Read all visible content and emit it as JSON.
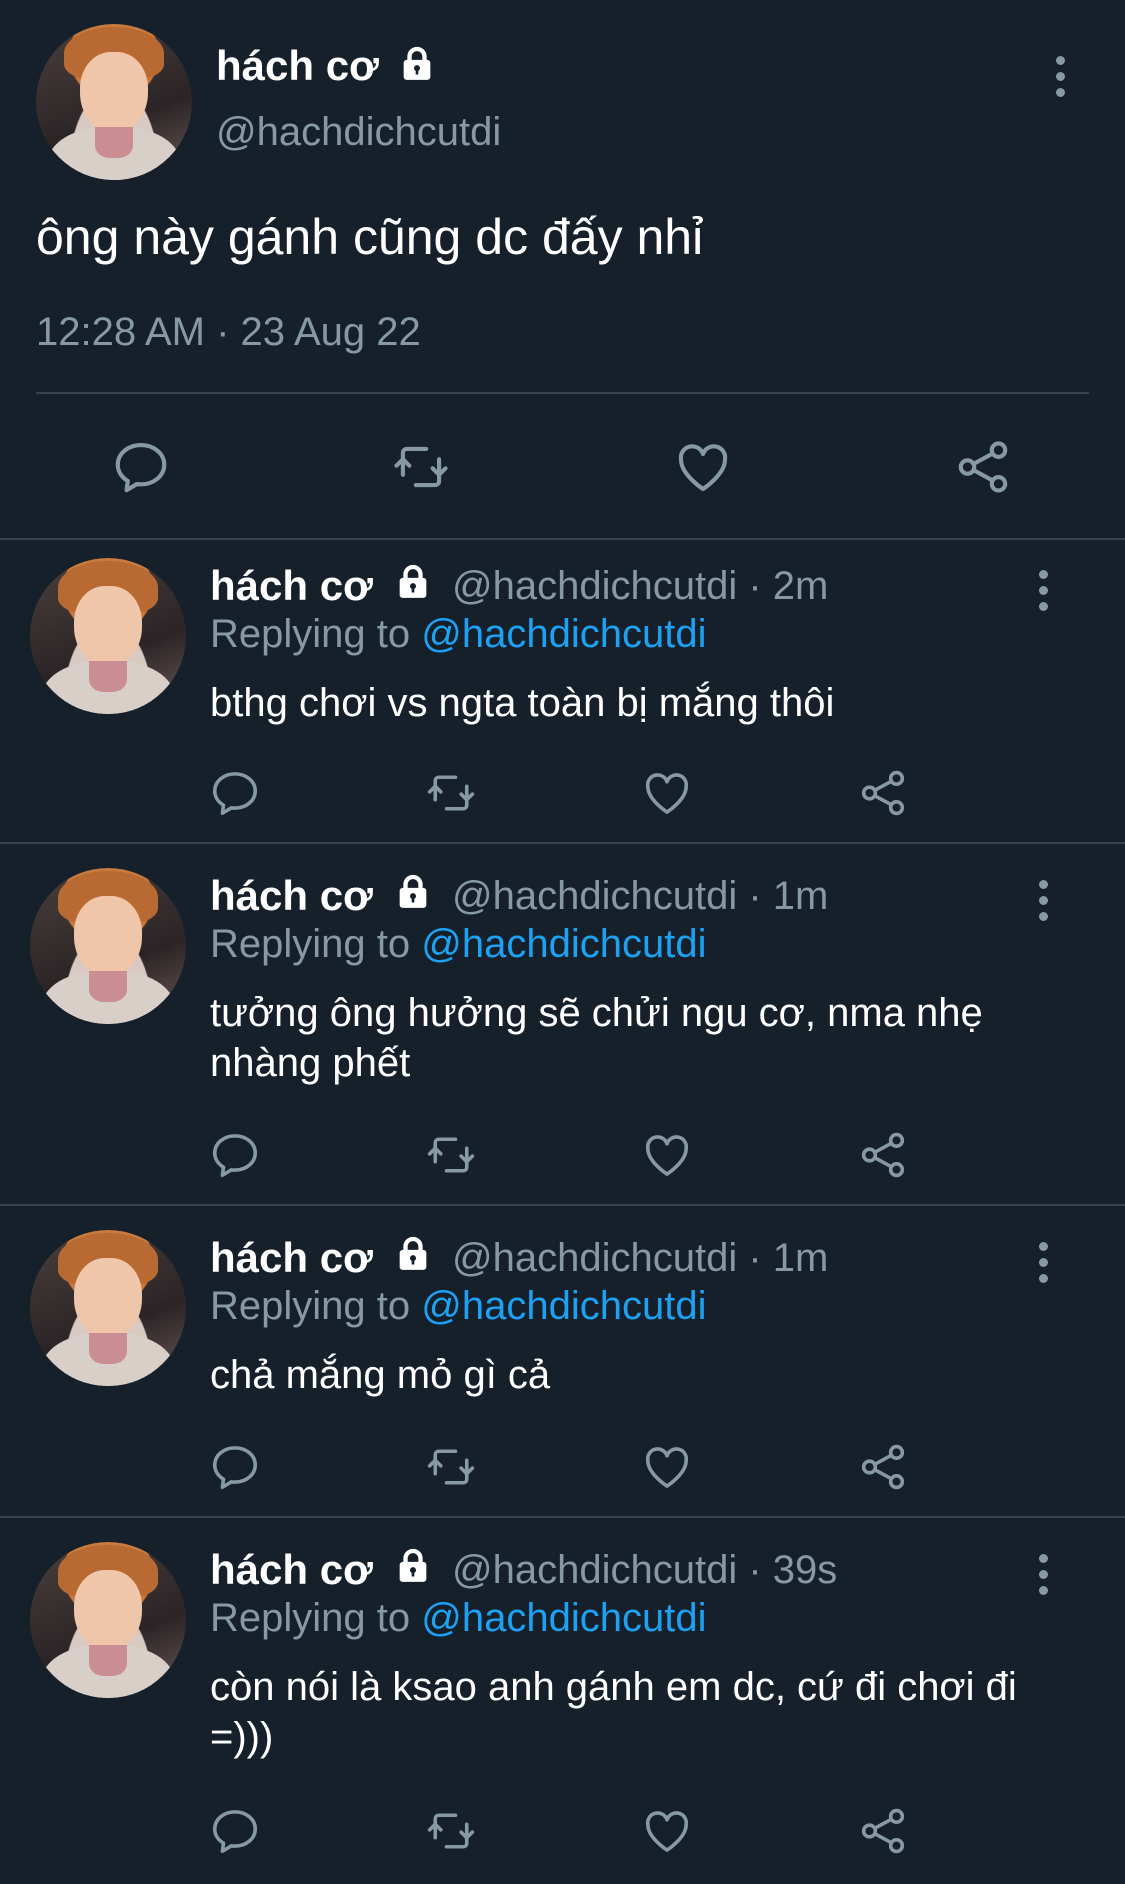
{
  "colors": {
    "background": "#15202b",
    "secondary_text": "#8899a6",
    "divider": "#38444d",
    "mention": "#1da1f2"
  },
  "icons": {
    "protected": "lock-icon",
    "more": "more-vertical-icon",
    "reply": "reply-icon",
    "retweet": "retweet-icon",
    "like": "like-icon",
    "share": "share-icon"
  },
  "main_tweet": {
    "name": "hách cơ",
    "handle": "@hachdichcutdi",
    "text": "ông này gánh cũng dc đấy nhỉ",
    "timestamp": "12:28 AM · 23 Aug 22"
  },
  "replies": [
    {
      "name": "hách cơ",
      "handle": "@hachdichcutdi · 2m",
      "replying_prefix": "Replying to ",
      "replying_to": "@hachdichcutdi",
      "text": "bthg chơi vs ngta toàn bị mắng thôi"
    },
    {
      "name": "hách cơ",
      "handle": "@hachdichcutdi · 1m",
      "replying_prefix": "Replying to ",
      "replying_to": "@hachdichcutdi",
      "text": "tưởng ông hưởng sẽ chửi ngu cơ, nma nhẹ nhàng phết"
    },
    {
      "name": "hách cơ",
      "handle": "@hachdichcutdi · 1m",
      "replying_prefix": "Replying to ",
      "replying_to": "@hachdichcutdi",
      "text": "chả mắng mỏ gì cả"
    },
    {
      "name": "hách cơ",
      "handle": "@hachdichcutdi · 39s",
      "replying_prefix": "Replying to ",
      "replying_to": "@hachdichcutdi",
      "text": "còn nói là ksao anh gánh em dc, cứ đi chơi đi =)))"
    }
  ]
}
